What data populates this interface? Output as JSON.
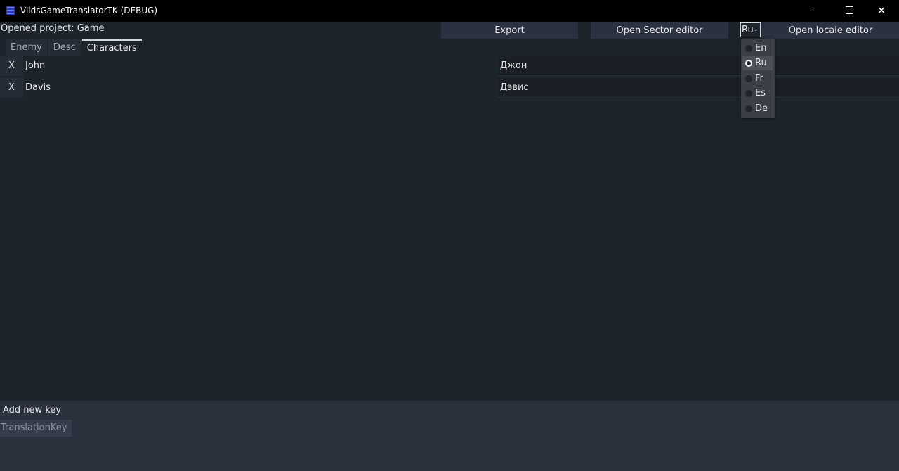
{
  "window": {
    "title": "ViidsGameTranslatorTK (DEBUG)",
    "minimize_icon": "minimize-icon",
    "maximize_icon": "maximize-icon",
    "close_label": "✕"
  },
  "toolbar": {
    "project_label": "Opened project: Game",
    "export_label": "Export",
    "sector_editor_label": "Open Sector editor",
    "locale_selected": "Ru",
    "locale_editor_label": "Open locale editor"
  },
  "tabs": [
    {
      "label": "Enemy",
      "active": false
    },
    {
      "label": "Desc",
      "active": false
    },
    {
      "label": "Characters",
      "active": true
    }
  ],
  "rows": [
    {
      "delete_label": "X",
      "key": "John",
      "value": "Джон"
    },
    {
      "delete_label": "X",
      "key": "Davis",
      "value": "Дэвис"
    }
  ],
  "bottom": {
    "add_label": "Add new key",
    "key_input_placeholder": "TranslationKey"
  },
  "locale_dropdown": {
    "options": [
      "En",
      "Ru",
      "Fr",
      "Es",
      "De"
    ],
    "selected": "Ru"
  },
  "colors": {
    "background": "#1e242c",
    "titlebar": "#000000",
    "button": "#2b3140",
    "bottom_panel": "#2a303c",
    "dropdown": "#3b3f47"
  }
}
